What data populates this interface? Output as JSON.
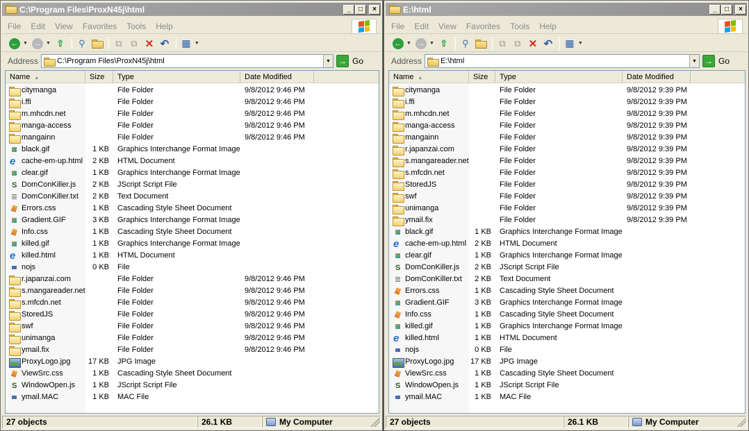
{
  "windows": [
    {
      "title": "C:\\Program Files\\ProxN45j\\html",
      "menu": [
        "File",
        "Edit",
        "View",
        "Favorites",
        "Tools",
        "Help"
      ],
      "address_label": "Address",
      "address": "C:\\Program Files\\ProxN45j\\html",
      "go_label": "Go",
      "columns": [
        "Name",
        "Size",
        "Type",
        "Date Modified"
      ],
      "files": [
        {
          "icon": "folder",
          "name": "citymanga",
          "size": "",
          "type": "File Folder",
          "date": "9/8/2012 9:46 PM"
        },
        {
          "icon": "folder",
          "name": "i.ffi",
          "size": "",
          "type": "File Folder",
          "date": "9/8/2012 9:46 PM"
        },
        {
          "icon": "folder",
          "name": "m.mhcdn.net",
          "size": "",
          "type": "File Folder",
          "date": "9/8/2012 9:46 PM"
        },
        {
          "icon": "folder",
          "name": "manga-access",
          "size": "",
          "type": "File Folder",
          "date": "9/8/2012 9:46 PM"
        },
        {
          "icon": "folder",
          "name": "mangainn",
          "size": "",
          "type": "File Folder",
          "date": "9/8/2012 9:46 PM"
        },
        {
          "icon": "gif",
          "name": "black.gif",
          "size": "1 KB",
          "type": "Graphics Interchange Format Image",
          "date": ""
        },
        {
          "icon": "html",
          "name": "cache-em-up.html",
          "size": "2 KB",
          "type": "HTML Document",
          "date": ""
        },
        {
          "icon": "gif",
          "name": "clear.gif",
          "size": "1 KB",
          "type": "Graphics Interchange Format Image",
          "date": ""
        },
        {
          "icon": "js",
          "name": "DomConKiller.js",
          "size": "2 KB",
          "type": "JScript Script File",
          "date": ""
        },
        {
          "icon": "txt",
          "name": "DomConKiller.txt",
          "size": "2 KB",
          "type": "Text Document",
          "date": ""
        },
        {
          "icon": "css",
          "name": "Errors.css",
          "size": "1 KB",
          "type": "Cascading Style Sheet Document",
          "date": ""
        },
        {
          "icon": "gif",
          "name": "Gradient.GIF",
          "size": "3 KB",
          "type": "Graphics Interchange Format Image",
          "date": ""
        },
        {
          "icon": "css",
          "name": "Info.css",
          "size": "1 KB",
          "type": "Cascading Style Sheet Document",
          "date": ""
        },
        {
          "icon": "gif",
          "name": "killed.gif",
          "size": "1 KB",
          "type": "Graphics Interchange Format Image",
          "date": ""
        },
        {
          "icon": "html",
          "name": "killed.html",
          "size": "1 KB",
          "type": "HTML Document",
          "date": ""
        },
        {
          "icon": "file",
          "name": "nojs",
          "size": "0 KB",
          "type": "File",
          "date": ""
        },
        {
          "icon": "folder",
          "name": "r.japanzai.com",
          "size": "",
          "type": "File Folder",
          "date": "9/8/2012 9:46 PM"
        },
        {
          "icon": "folder",
          "name": "s.mangareader.net",
          "size": "",
          "type": "File Folder",
          "date": "9/8/2012 9:46 PM"
        },
        {
          "icon": "folder",
          "name": "s.mfcdn.net",
          "size": "",
          "type": "File Folder",
          "date": "9/8/2012 9:46 PM"
        },
        {
          "icon": "folder",
          "name": "StoredJS",
          "size": "",
          "type": "File Folder",
          "date": "9/8/2012 9:46 PM"
        },
        {
          "icon": "folder",
          "name": "swf",
          "size": "",
          "type": "File Folder",
          "date": "9/8/2012 9:46 PM"
        },
        {
          "icon": "folder",
          "name": "unimanga",
          "size": "",
          "type": "File Folder",
          "date": "9/8/2012 9:46 PM"
        },
        {
          "icon": "folder",
          "name": "ymail.fix",
          "size": "",
          "type": "File Folder",
          "date": "9/8/2012 9:46 PM"
        },
        {
          "icon": "image",
          "name": "ProxyLogo.jpg",
          "size": "17 KB",
          "type": "JPG Image",
          "date": ""
        },
        {
          "icon": "css",
          "name": "ViewSrc.css",
          "size": "1 KB",
          "type": "Cascading Style Sheet Document",
          "date": ""
        },
        {
          "icon": "js",
          "name": "WindowOpen.js",
          "size": "1 KB",
          "type": "JScript Script File",
          "date": ""
        },
        {
          "icon": "file",
          "name": "ymail.MAC",
          "size": "1 KB",
          "type": "MAC File",
          "date": ""
        }
      ],
      "status": {
        "objects": "27 objects",
        "size": "26.1 KB",
        "location": "My Computer"
      }
    },
    {
      "title": "E:\\html",
      "menu": [
        "File",
        "Edit",
        "View",
        "Favorites",
        "Tools",
        "Help"
      ],
      "address_label": "Address",
      "address": "E:\\html",
      "go_label": "Go",
      "columns": [
        "Name",
        "Size",
        "Type",
        "Date Modified"
      ],
      "files": [
        {
          "icon": "folder",
          "name": "citymanga",
          "size": "",
          "type": "File Folder",
          "date": "9/8/2012 9:39 PM"
        },
        {
          "icon": "folder",
          "name": "i.ffi",
          "size": "",
          "type": "File Folder",
          "date": "9/8/2012 9:39 PM"
        },
        {
          "icon": "folder",
          "name": "m.mhcdn.net",
          "size": "",
          "type": "File Folder",
          "date": "9/8/2012 9:39 PM"
        },
        {
          "icon": "folder",
          "name": "manga-access",
          "size": "",
          "type": "File Folder",
          "date": "9/8/2012 9:39 PM"
        },
        {
          "icon": "folder",
          "name": "mangainn",
          "size": "",
          "type": "File Folder",
          "date": "9/8/2012 9:39 PM"
        },
        {
          "icon": "folder",
          "name": "r.japanzai.com",
          "size": "",
          "type": "File Folder",
          "date": "9/8/2012 9:39 PM"
        },
        {
          "icon": "folder",
          "name": "s.mangareader.net",
          "size": "",
          "type": "File Folder",
          "date": "9/8/2012 9:39 PM"
        },
        {
          "icon": "folder",
          "name": "s.mfcdn.net",
          "size": "",
          "type": "File Folder",
          "date": "9/8/2012 9:39 PM"
        },
        {
          "icon": "folder",
          "name": "StoredJS",
          "size": "",
          "type": "File Folder",
          "date": "9/8/2012 9:39 PM"
        },
        {
          "icon": "folder",
          "name": "swf",
          "size": "",
          "type": "File Folder",
          "date": "9/8/2012 9:39 PM"
        },
        {
          "icon": "folder",
          "name": "unimanga",
          "size": "",
          "type": "File Folder",
          "date": "9/8/2012 9:39 PM"
        },
        {
          "icon": "folder",
          "name": "ymail.fix",
          "size": "",
          "type": "File Folder",
          "date": "9/8/2012 9:39 PM"
        },
        {
          "icon": "gif",
          "name": "black.gif",
          "size": "1 KB",
          "type": "Graphics Interchange Format Image",
          "date": ""
        },
        {
          "icon": "html",
          "name": "cache-em-up.html",
          "size": "2 KB",
          "type": "HTML Document",
          "date": ""
        },
        {
          "icon": "gif",
          "name": "clear.gif",
          "size": "1 KB",
          "type": "Graphics Interchange Format Image",
          "date": ""
        },
        {
          "icon": "js",
          "name": "DomConKiller.js",
          "size": "2 KB",
          "type": "JScript Script File",
          "date": ""
        },
        {
          "icon": "txt",
          "name": "DomConKiller.txt",
          "size": "2 KB",
          "type": "Text Document",
          "date": ""
        },
        {
          "icon": "css",
          "name": "Errors.css",
          "size": "1 KB",
          "type": "Cascading Style Sheet Document",
          "date": ""
        },
        {
          "icon": "gif",
          "name": "Gradient.GIF",
          "size": "3 KB",
          "type": "Graphics Interchange Format Image",
          "date": ""
        },
        {
          "icon": "css",
          "name": "Info.css",
          "size": "1 KB",
          "type": "Cascading Style Sheet Document",
          "date": ""
        },
        {
          "icon": "gif",
          "name": "killed.gif",
          "size": "1 KB",
          "type": "Graphics Interchange Format Image",
          "date": ""
        },
        {
          "icon": "html",
          "name": "killed.html",
          "size": "1 KB",
          "type": "HTML Document",
          "date": ""
        },
        {
          "icon": "file",
          "name": "nojs",
          "size": "0 KB",
          "type": "File",
          "date": ""
        },
        {
          "icon": "image",
          "name": "ProxyLogo.jpg",
          "size": "17 KB",
          "type": "JPG Image",
          "date": ""
        },
        {
          "icon": "css",
          "name": "ViewSrc.css",
          "size": "1 KB",
          "type": "Cascading Style Sheet Document",
          "date": ""
        },
        {
          "icon": "js",
          "name": "WindowOpen.js",
          "size": "1 KB",
          "type": "JScript Script File",
          "date": ""
        },
        {
          "icon": "file",
          "name": "ymail.MAC",
          "size": "1 KB",
          "type": "MAC File",
          "date": ""
        }
      ],
      "status": {
        "objects": "27 objects",
        "size": "26.1 KB",
        "location": "My Computer"
      }
    }
  ],
  "colors": {
    "titlebar": "#9a9a9a",
    "window_bg": "#ece9d8",
    "go_green": "#3aa63a",
    "winflag": [
      "#f25022",
      "#7fba00",
      "#00a4ef",
      "#ffb900"
    ]
  }
}
